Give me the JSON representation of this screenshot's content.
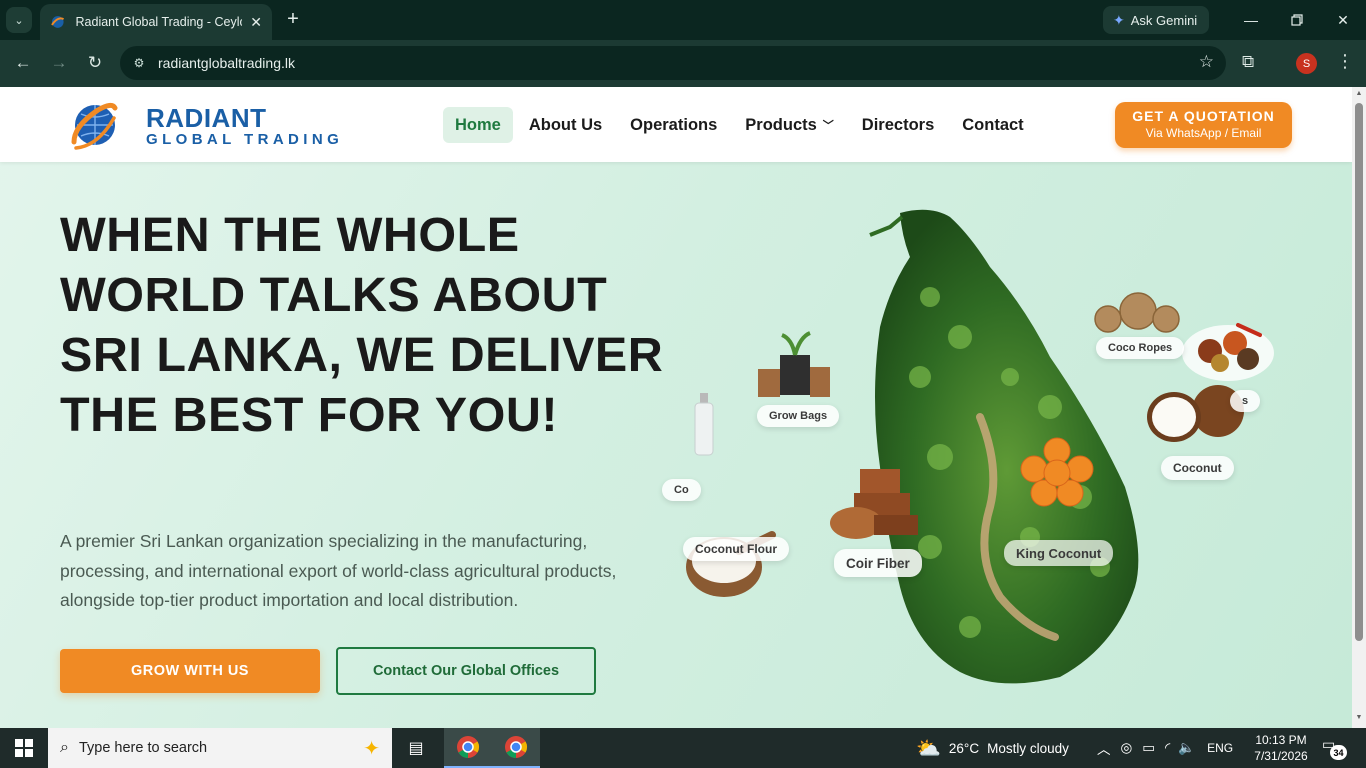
{
  "browser": {
    "tab_title": "Radiant Global Trading - Ceylon",
    "tab_close": "✕",
    "new_tab": "+",
    "gemini_label": "Ask Gemini",
    "url": "radiantglobaltrading.lk",
    "profile_initial": "S"
  },
  "header": {
    "brand_line1": "RADIANT",
    "brand_line2": "GLOBAL TRADING",
    "nav": [
      {
        "label": "Home",
        "active": true
      },
      {
        "label": "About Us"
      },
      {
        "label": "Operations"
      },
      {
        "label": "Products",
        "dropdown": true
      },
      {
        "label": "Directors"
      },
      {
        "label": "Contact"
      }
    ],
    "quote_line1": "GET A QUOTATION",
    "quote_line2": "Via WhatsApp / Email"
  },
  "hero": {
    "title": "WHEN THE WHOLE WORLD TALKS ABOUT SRI LANKA, WE DELIVER THE BEST FOR YOU!",
    "subtitle": "A premier Sri Lankan organization specializing in the manufacturing, processing, and international export of world-class agricultural products, alongside top-tier product importation and local distribution.",
    "primary_cta": "GROW WITH US",
    "secondary_cta": "Contact Our Global Offices"
  },
  "products": {
    "coco_ropes": "Coco Ropes",
    "grow_bags": "Grow Bags",
    "spices_partial": "s",
    "coconut": "Coconut",
    "coconut_oil_partial": "Co",
    "coconut_flour": "Coconut Flour",
    "coir_fiber": "Coir Fiber",
    "king_coconut": "King Coconut"
  },
  "taskbar": {
    "search_placeholder": "Type here to search",
    "weather_temp": "26°C",
    "weather_desc": "Mostly cloudy",
    "language": "ENG",
    "time": "10:13 PM",
    "date": "7/31/2026",
    "notification_count": "34"
  },
  "colors": {
    "brand_blue": "#1a5fa6",
    "accent_orange": "#f08a24",
    "accent_green": "#1f7a40",
    "chrome_dark": "#0b2620"
  }
}
